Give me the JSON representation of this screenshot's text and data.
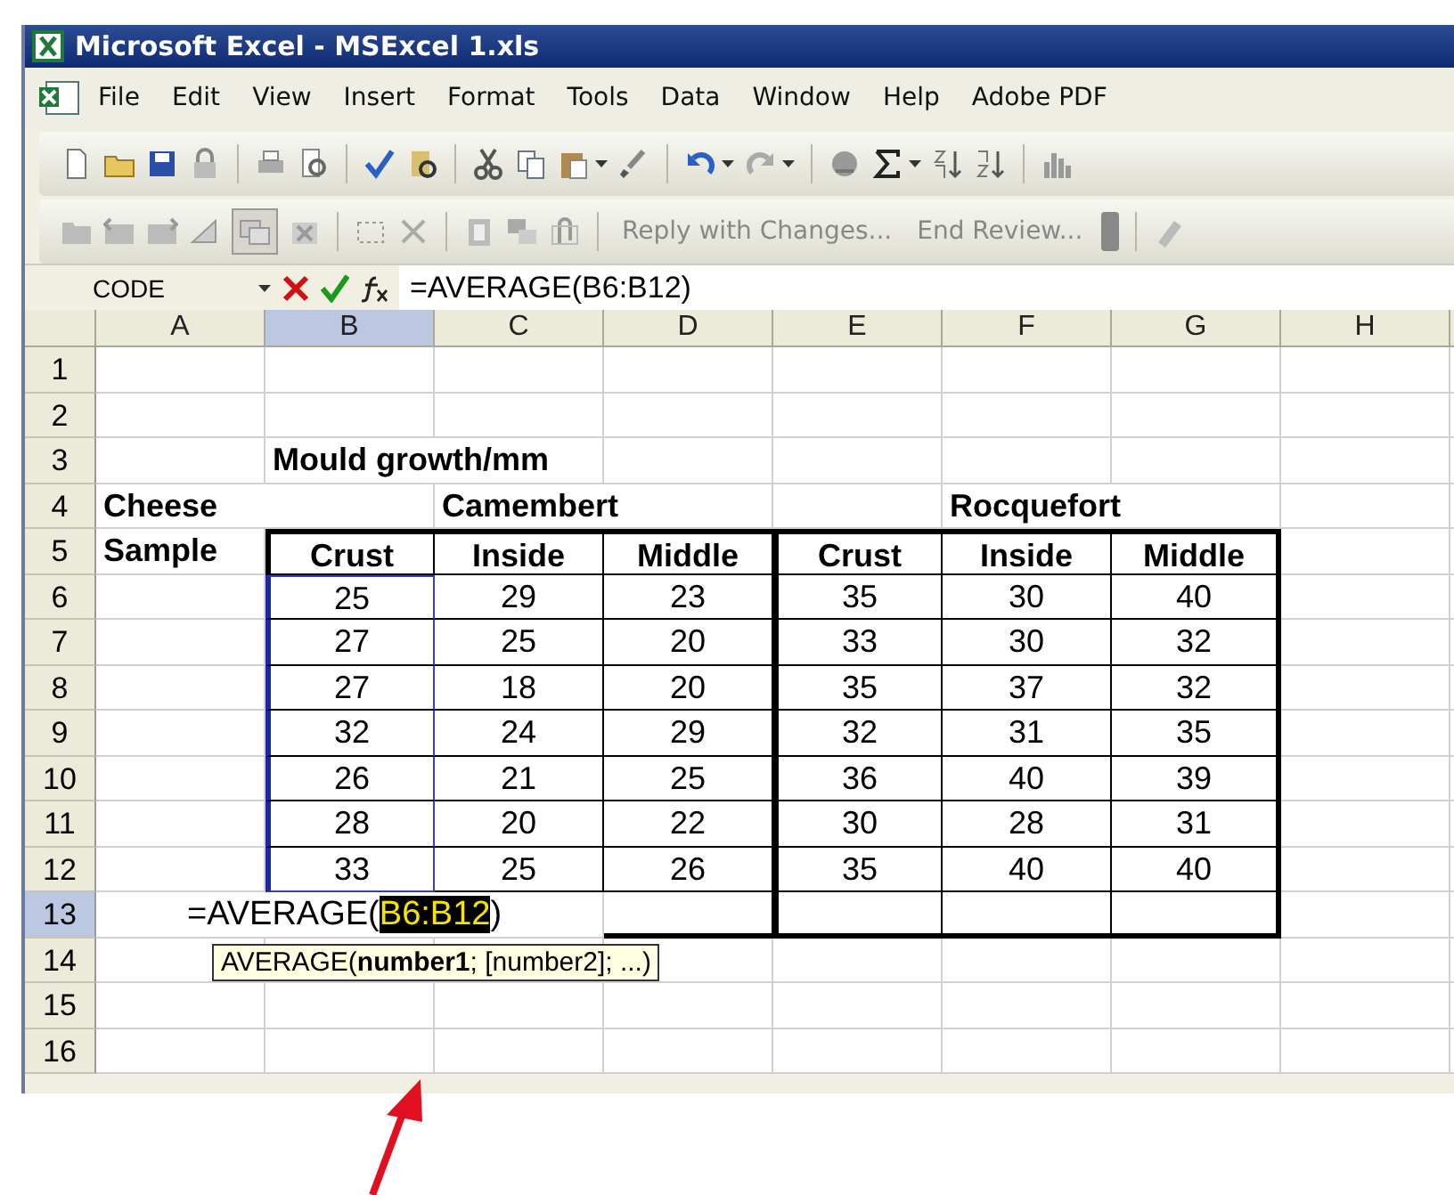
{
  "window": {
    "title": "Microsoft Excel - MSExcel 1.xls"
  },
  "menu": [
    "File",
    "Edit",
    "View",
    "Insert",
    "Format",
    "Tools",
    "Data",
    "Window",
    "Help",
    "Adobe PDF"
  ],
  "review_toolbar": {
    "buttons": [
      "Reply with Changes...",
      "End Review..."
    ]
  },
  "formula_bar": {
    "name_box": "CODE",
    "formula": "=AVERAGE(B6:B12)"
  },
  "sheet": {
    "columns": [
      {
        "label": "A",
        "selected": false
      },
      {
        "label": "B",
        "selected": true
      },
      {
        "label": "C",
        "selected": false
      },
      {
        "label": "D",
        "selected": false
      },
      {
        "label": "E",
        "selected": false
      },
      {
        "label": "F",
        "selected": false
      },
      {
        "label": "G",
        "selected": false
      },
      {
        "label": "H",
        "selected": false
      }
    ],
    "rows": [
      {
        "number": "1",
        "selected": false,
        "kind": "blank"
      },
      {
        "number": "2",
        "selected": false,
        "kind": "blank"
      },
      {
        "number": "3",
        "selected": false,
        "kind": "label",
        "cells": [
          null,
          "Mould growth/mm",
          null,
          null,
          null,
          null,
          null,
          null
        ]
      },
      {
        "number": "4",
        "selected": false,
        "kind": "label",
        "cells": [
          "Cheese",
          null,
          "Camembert",
          null,
          null,
          "Rocquefort",
          null,
          null
        ]
      },
      {
        "number": "5",
        "selected": false,
        "kind": "header",
        "cells": [
          "Sample",
          "Crust",
          "Inside",
          "Middle",
          "Crust",
          "Inside",
          "Middle",
          null
        ]
      },
      {
        "number": "6",
        "selected": false,
        "kind": "data",
        "cells": [
          null,
          "25",
          "29",
          "23",
          "35",
          "30",
          "40",
          null
        ]
      },
      {
        "number": "7",
        "selected": false,
        "kind": "data",
        "cells": [
          null,
          "27",
          "25",
          "20",
          "33",
          "30",
          "32",
          null
        ]
      },
      {
        "number": "8",
        "selected": false,
        "kind": "data",
        "cells": [
          null,
          "27",
          "18",
          "20",
          "35",
          "37",
          "32",
          null
        ]
      },
      {
        "number": "9",
        "selected": false,
        "kind": "data",
        "cells": [
          null,
          "32",
          "24",
          "29",
          "32",
          "31",
          "35",
          null
        ]
      },
      {
        "number": "10",
        "selected": false,
        "kind": "data",
        "cells": [
          null,
          "26",
          "21",
          "25",
          "36",
          "40",
          "39",
          null
        ]
      },
      {
        "number": "11",
        "selected": false,
        "kind": "data",
        "cells": [
          null,
          "28",
          "20",
          "22",
          "30",
          "28",
          "31",
          null
        ]
      },
      {
        "number": "12",
        "selected": false,
        "kind": "data",
        "cells": [
          null,
          "33",
          "25",
          "26",
          "35",
          "40",
          "40",
          null
        ]
      },
      {
        "number": "13",
        "selected": true,
        "kind": "edit",
        "editor": {
          "before": "=AVERAGE(",
          "selection": "B6:B12",
          "after": ")"
        }
      },
      {
        "number": "14",
        "selected": false,
        "kind": "tip",
        "tooltip": "AVERAGE(**number1**; [number2]; ...)"
      },
      {
        "number": "15",
        "selected": false,
        "kind": "blank"
      },
      {
        "number": "16",
        "selected": false,
        "kind": "blank"
      }
    ]
  }
}
